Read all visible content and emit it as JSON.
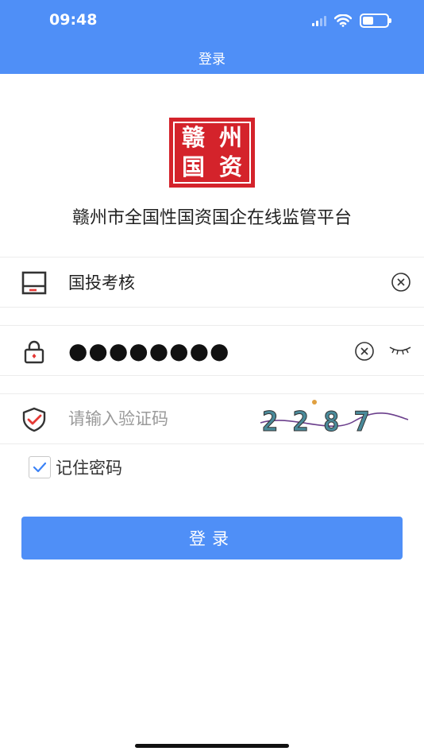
{
  "status_bar": {
    "time": "09:48"
  },
  "nav": {
    "title": "登录"
  },
  "logo": {
    "chars": [
      "赣",
      "州",
      "国",
      "资"
    ]
  },
  "app_title": "赣州市全国性国资国企在线监管平台",
  "form": {
    "username": {
      "value": "国投考核"
    },
    "password": {
      "masked": "●●●●●●●●"
    },
    "captcha": {
      "placeholder": "请输入验证码",
      "code": "2287"
    },
    "remember": {
      "label": "记住密码",
      "checked": true
    },
    "login_label": "登录"
  },
  "colors": {
    "primary": "#4f8ff7",
    "logo_red": "#d4232b",
    "check_blue": "#3b82f6"
  }
}
